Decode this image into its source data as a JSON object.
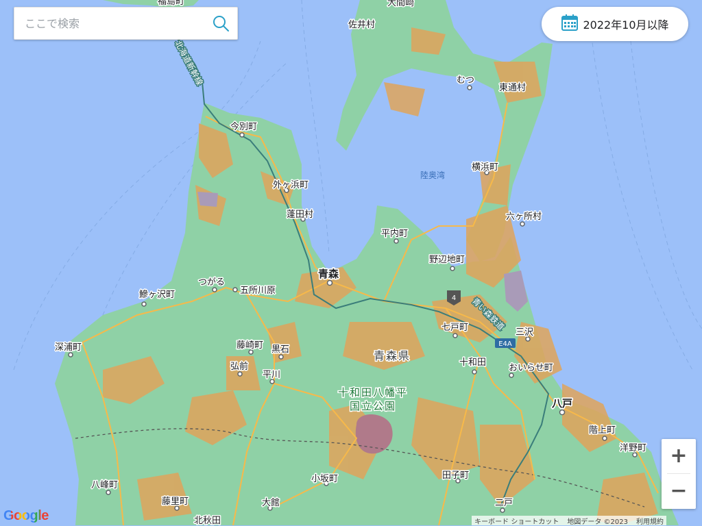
{
  "search": {
    "placeholder": "ここで検索"
  },
  "date_filter": {
    "label": "2022年10月以降"
  },
  "map": {
    "colors": {
      "sea": "#9cc0f9",
      "land": "#8fd1a6",
      "urban": "#dfa45c",
      "road": "#f7b94a",
      "rail": "#3a7d7a"
    },
    "water_label": "陸奥湾",
    "pref_label": "青森県",
    "park_label_1": "十和田八幡平",
    "park_label_2": "国立公園",
    "rail_label": "北海道新幹線",
    "rail_label_2": "青い森鉄道",
    "route_shield": "4",
    "expressway_shield": "E4A",
    "places": {
      "fukushima": "福島町",
      "oma": "大間崎",
      "sai": "佐井村",
      "mutsu": "むつ",
      "higashidori": "東通村",
      "imabetsu": "今別町",
      "sotogahama": "外ヶ浜町",
      "yokohama": "横浜町",
      "yomogita": "蓬田村",
      "rokkasho": "六ヶ所村",
      "hiranai": "平内町",
      "noheji": "野辺地町",
      "aomori": "青森",
      "tsugaru": "つがる",
      "goshogawara": "五所川原",
      "ajigasawa": "鰺ヶ沢町",
      "shichinohe": "七戸町",
      "misawa": "三沢",
      "fukaura": "深浦町",
      "fujisaki": "藤崎町",
      "kuroishi": "黒石",
      "towada": "十和田",
      "oirase": "おいらせ町",
      "hirosaki": "弘前",
      "hirakawa": "平川",
      "hachinohe": "八戸",
      "hashikami": "階上町",
      "yono": "洋野町",
      "happo": "八峰町",
      "tashiko": "田子町",
      "kosaka": "小坂町",
      "fujisato": "藤里町",
      "odate": "大館",
      "ninohe": "二戸",
      "kitaakita": "北秋田"
    }
  },
  "zoom": {
    "in_label": "+",
    "out_label": "−"
  },
  "footer": {
    "google": "Google",
    "shortcuts": "キーボード ショートカット",
    "mapdata": "地図データ ©2023",
    "terms": "利用規約"
  }
}
